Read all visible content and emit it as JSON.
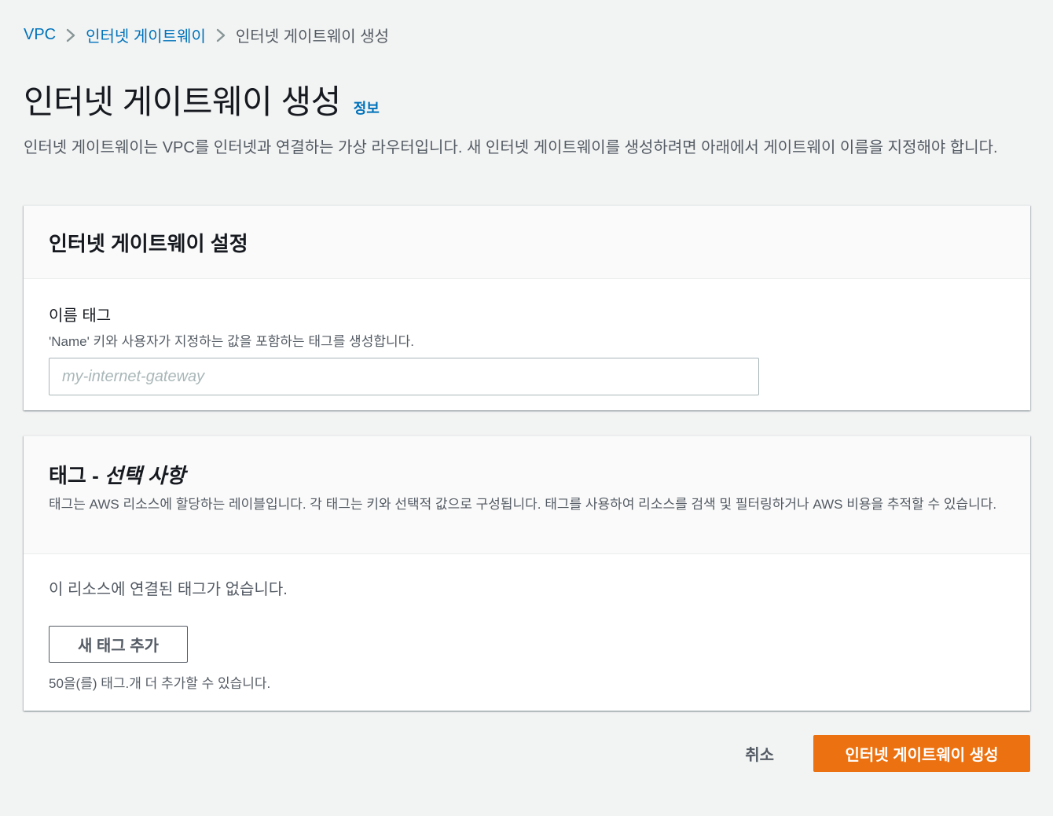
{
  "breadcrumb": {
    "items": [
      {
        "label": "VPC"
      },
      {
        "label": "인터넷 게이트웨이"
      },
      {
        "label": "인터넷 게이트웨이 생성"
      }
    ]
  },
  "header": {
    "title": "인터넷 게이트웨이 생성",
    "info_link": "정보",
    "description": "인터넷 게이트웨이는 VPC를 인터넷과 연결하는 가상 라우터입니다. 새 인터넷 게이트웨이를 생성하려면 아래에서 게이트웨이 이름을 지정해야 합니다."
  },
  "settings_panel": {
    "title": "인터넷 게이트웨이 설정",
    "name_tag": {
      "label": "이름 태그",
      "description": "'Name' 키와 사용자가 지정하는 값을 포함하는 태그를 생성합니다.",
      "value": "",
      "placeholder": "my-internet-gateway"
    }
  },
  "tags_panel": {
    "title": "태그 - ",
    "title_optional": "선택 사항",
    "description": "태그는 AWS 리소스에 할당하는 레이블입니다. 각 태그는 키와 선택적 값으로 구성됩니다. 태그를 사용하여 리소스를 검색 및 필터링하거나 AWS 비용을 추적할 수 있습니다.",
    "empty_text": "이 리소스에 연결된 태그가 없습니다.",
    "add_button": "새 태그 추가",
    "limit_text": "50을(를) 태그.개 더 추가할 수 있습니다."
  },
  "actions": {
    "cancel": "취소",
    "submit": "인터넷 게이트웨이 생성"
  },
  "colors": {
    "link": "#0073bb",
    "primary": "#ec7211",
    "background": "#f2f3f3",
    "text_secondary": "#545b64"
  },
  "icons": {
    "breadcrumb_separator": "chevron-right-icon"
  }
}
